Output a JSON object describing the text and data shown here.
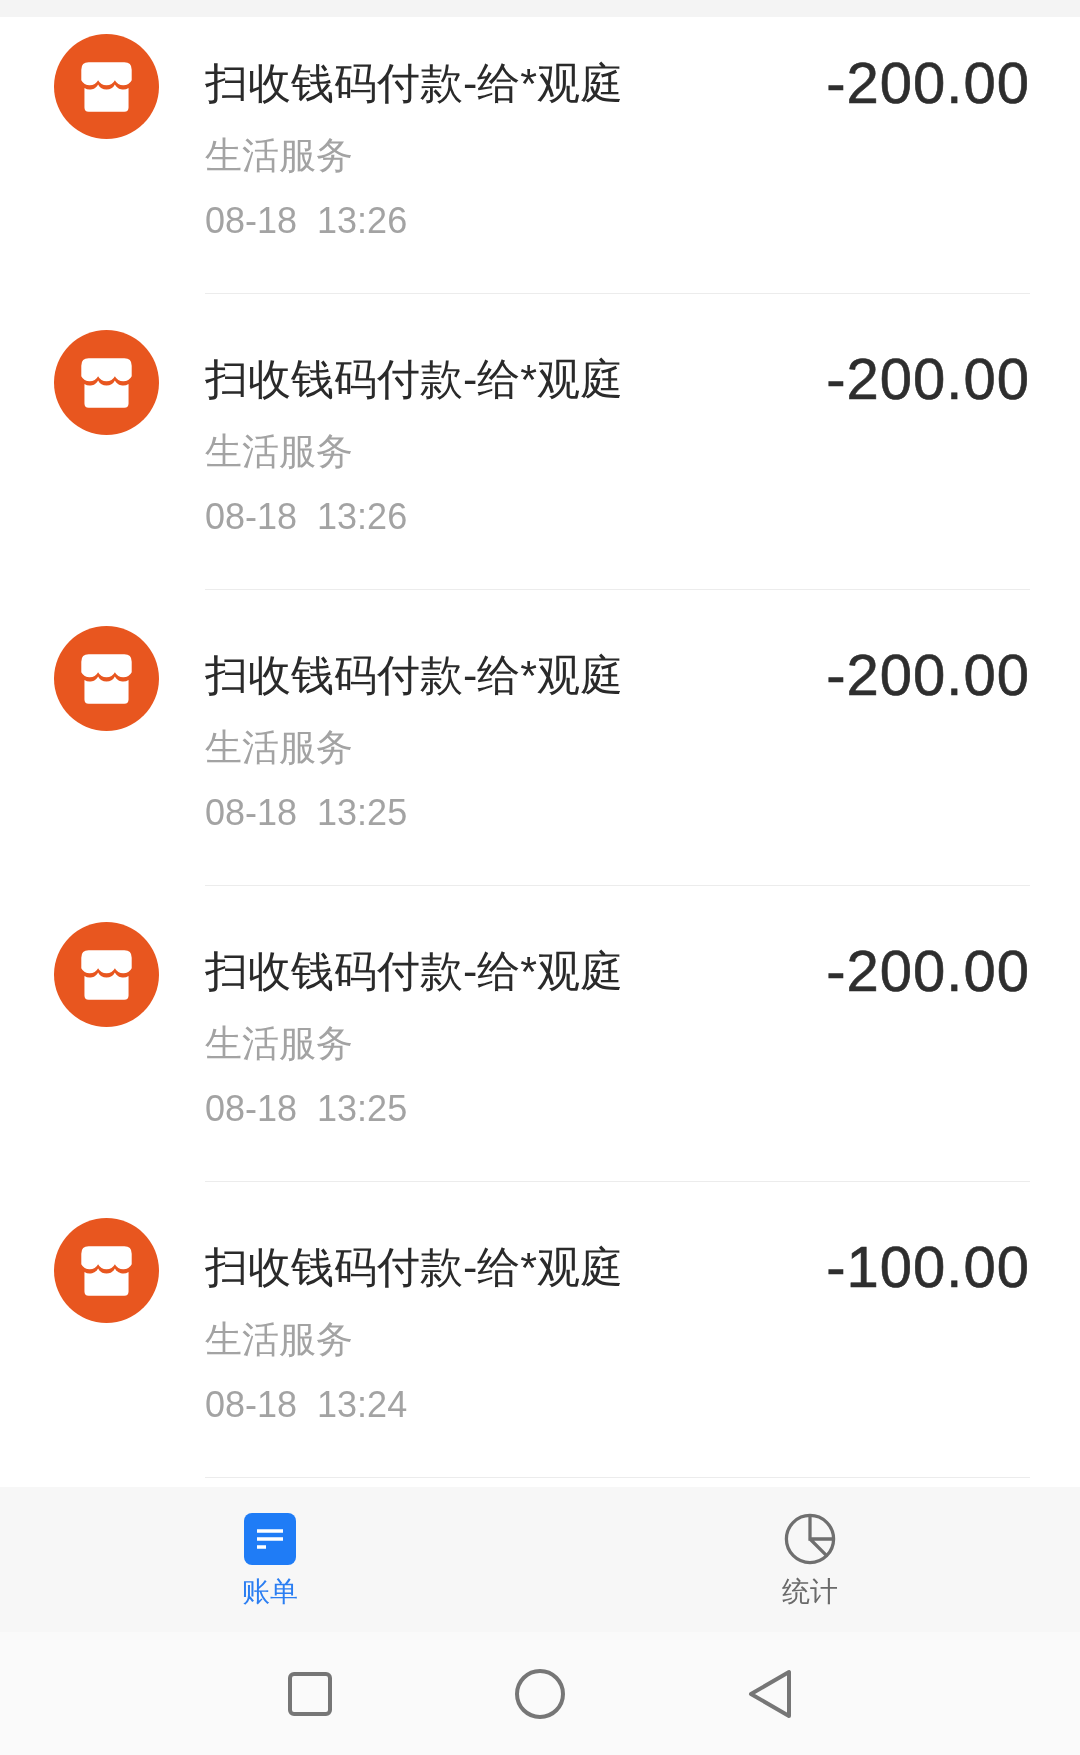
{
  "transactions": [
    {
      "title": "扫收钱码付款-给*观庭",
      "category": "生活服务",
      "time": "08-18  13:26",
      "amount": "-200.00"
    },
    {
      "title": "扫收钱码付款-给*观庭",
      "category": "生活服务",
      "time": "08-18  13:26",
      "amount": "-200.00"
    },
    {
      "title": "扫收钱码付款-给*观庭",
      "category": "生活服务",
      "time": "08-18  13:25",
      "amount": "-200.00"
    },
    {
      "title": "扫收钱码付款-给*观庭",
      "category": "生活服务",
      "time": "08-18  13:25",
      "amount": "-200.00"
    },
    {
      "title": "扫收钱码付款-给*观庭",
      "category": "生活服务",
      "time": "08-18  13:24",
      "amount": "-100.00"
    }
  ],
  "tab_bar": {
    "tabs": [
      {
        "label": "账单",
        "selected": true
      },
      {
        "label": "统计",
        "selected": false
      }
    ]
  }
}
